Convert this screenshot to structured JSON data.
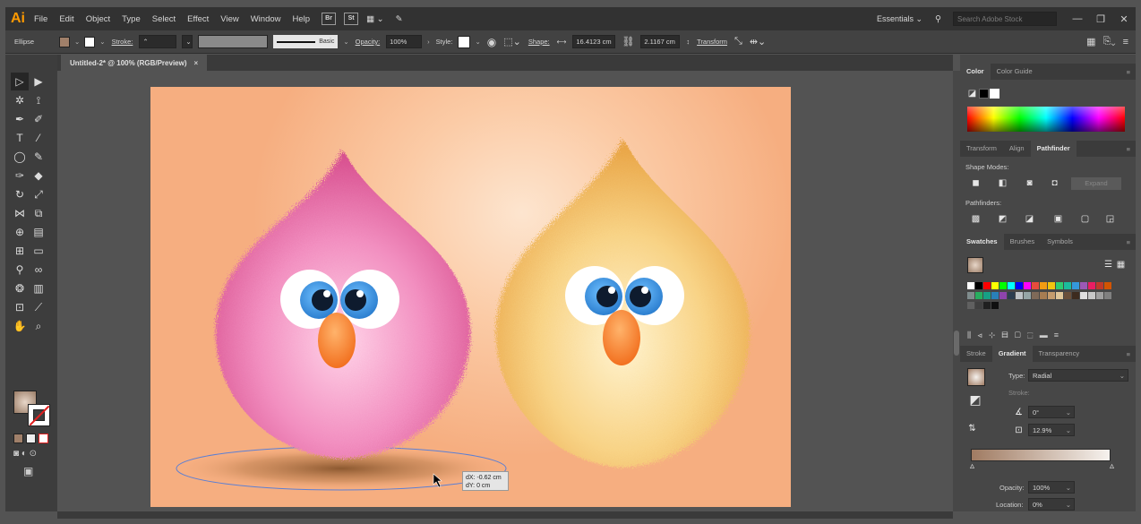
{
  "menubar": {
    "logo": "Ai",
    "menus": [
      "File",
      "Edit",
      "Object",
      "Type",
      "Select",
      "Effect",
      "View",
      "Window",
      "Help"
    ],
    "bridge_label": "Br",
    "stock_label": "St",
    "workspace": "Essentials",
    "stock_search_placeholder": "Search Adobe Stock"
  },
  "controlbar": {
    "selection_type": "Ellipse",
    "stroke_label": "Stroke:",
    "brush_label": "Basic",
    "opacity_label": "Opacity:",
    "opacity_value": "100%",
    "style_label": "Style:",
    "shape_label": "Shape:",
    "width_value": "16.4123 cm",
    "height_value": "2.1167 cm",
    "transform_label": "Transform"
  },
  "document": {
    "tab_title": "Untitled-2* @ 100% (RGB/Preview)",
    "close": "×"
  },
  "measure_tooltip": {
    "dx": "dX: -0.62 cm",
    "dy": "dY: 0 cm"
  },
  "panels": {
    "color_tabs": [
      "Color",
      "Color Guide"
    ],
    "transform_tabs": [
      "Transform",
      "Align",
      "Pathfinder"
    ],
    "shape_modes_label": "Shape Modes:",
    "expand_label": "Expand",
    "pathfinders_label": "Pathfinders:",
    "swatch_tabs": [
      "Swatches",
      "Brushes",
      "Symbols"
    ],
    "gradient_tabs": [
      "Stroke",
      "Gradient",
      "Transparency"
    ],
    "type_label": "Type:",
    "type_value": "Radial",
    "angle_value": "0°",
    "aspect_value": "12.9%",
    "opacity_label": "Opacity:",
    "opacity_value": "100%",
    "location_label": "Location:",
    "location_value": "0%"
  },
  "colors": {
    "artboard_bg": "#fbcba6",
    "pink_fur": "#f07ab0",
    "yellow_fur": "#f8c76c",
    "beak": "#f5832a",
    "iris": "#3b8fd8"
  },
  "swatch_colors": [
    "#ffffff",
    "#000000",
    "#ff0000",
    "#ffff00",
    "#00ff00",
    "#00ffff",
    "#0000ff",
    "#ff00ff",
    "#e84c3c",
    "#f39c12",
    "#f1c40f",
    "#2ecc71",
    "#1abc9c",
    "#3498db",
    "#9b59b6",
    "#e91e63",
    "#c0392b",
    "#d35400",
    "#7f8c8d",
    "#27ae60",
    "#16a085",
    "#2980b9",
    "#8e44ad",
    "#2c3e50",
    "#bdc3c7",
    "#95a5a6",
    "#7f6a58",
    "#a67c52",
    "#c69c6d",
    "#e1c699",
    "#6b4f3a",
    "#3d2b1f",
    "#e0e0e0",
    "#c8c8c8",
    "#a0a0a0",
    "#808080",
    "#606060",
    "#404040",
    "#202020",
    "#101010"
  ]
}
